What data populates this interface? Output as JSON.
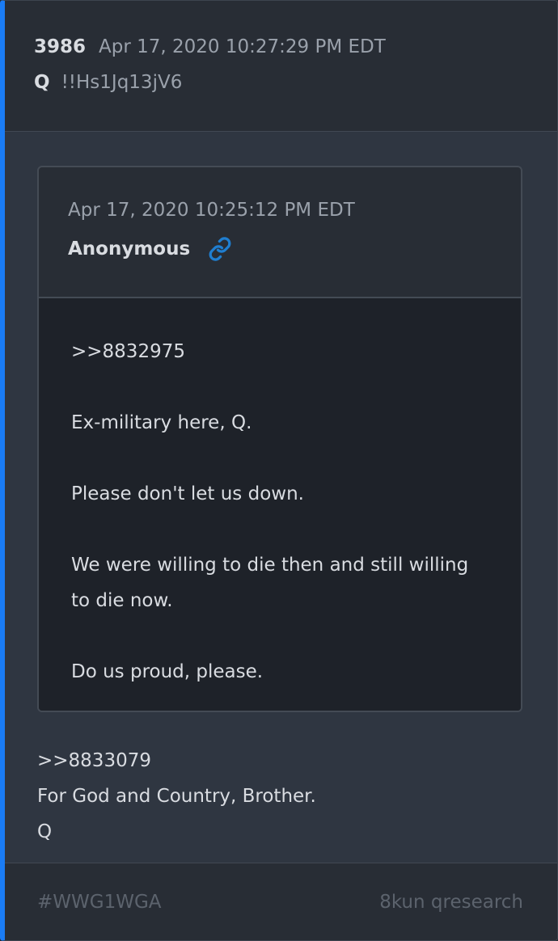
{
  "post": {
    "number": "3986",
    "date": "Apr 17, 2020 10:27:29 PM EDT",
    "author": "Q",
    "tripcode": "!!Hs1Jq13jV6"
  },
  "quoted": {
    "date": "Apr 17, 2020 10:25:12 PM EDT",
    "author": "Anonymous",
    "link_icon": "link-icon",
    "lines": [
      ">>8832975",
      "Ex-military here, Q.",
      "Please don't let us down.",
      "We were willing to die then and still willing to die now.",
      "Do us proud, please."
    ]
  },
  "reply": {
    "lines": [
      ">>8833079",
      "For God and Country, Brother.",
      "Q"
    ]
  },
  "footer": {
    "hashtag": "#WWG1WGA",
    "source": "8kun qresearch"
  },
  "colors": {
    "accent": "#1a7cf5",
    "link_icon": "#1f7ed0",
    "card_bg": "#2f3641",
    "header_bg": "#282d35",
    "quote_body_bg": "#1e2229"
  }
}
